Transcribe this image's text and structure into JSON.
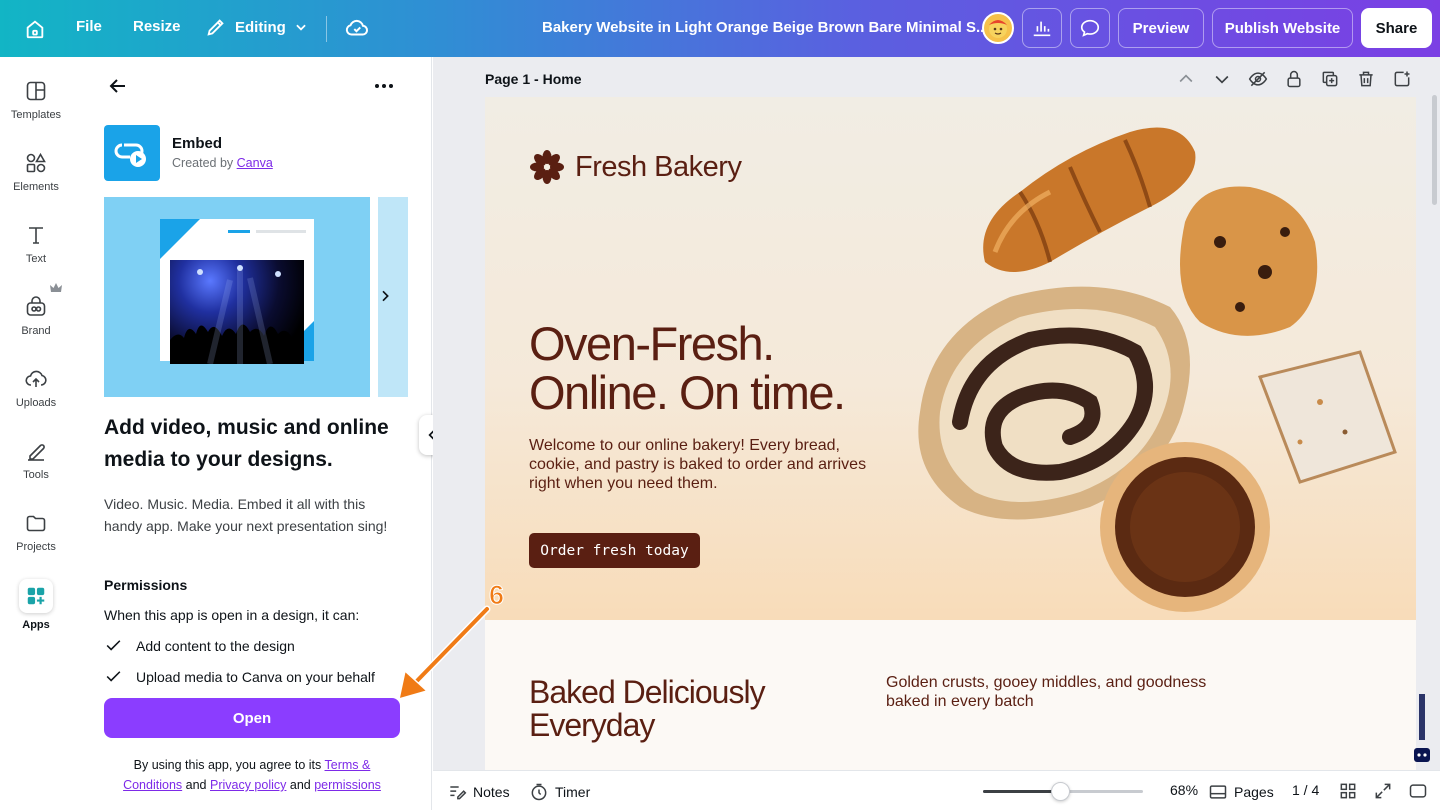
{
  "topbar": {
    "file": "File",
    "resize": "Resize",
    "editing": "Editing",
    "title": "Bakery Website in Light Orange Beige Brown Bare Minimal S...",
    "preview": "Preview",
    "publish": "Publish Website",
    "share": "Share"
  },
  "rail": {
    "items": [
      {
        "label": "Templates",
        "icon": "templates-icon"
      },
      {
        "label": "Elements",
        "icon": "elements-icon"
      },
      {
        "label": "Text",
        "icon": "text-icon"
      },
      {
        "label": "Brand",
        "icon": "brand-icon"
      },
      {
        "label": "Uploads",
        "icon": "uploads-icon"
      },
      {
        "label": "Tools",
        "icon": "tools-icon"
      },
      {
        "label": "Projects",
        "icon": "projects-icon"
      },
      {
        "label": "Apps",
        "icon": "apps-icon"
      }
    ]
  },
  "panel": {
    "app_name": "Embed",
    "created_by": "Created by",
    "creator": "Canva",
    "heading": "Add video, music and online media to your designs.",
    "description": "Video. Music. Media. Embed it all with this handy app. Make your next presentation sing!",
    "permissions_title": "Permissions",
    "permissions_intro": "When this app is open in a design, it can:",
    "permissions": [
      "Add content to the design",
      "Upload media to Canva on your behalf"
    ],
    "open_button": "Open",
    "legal": {
      "prefix": "By using this app, you agree to its",
      "terms": "Terms & Conditions",
      "and1": "and",
      "privacy": "Privacy policy",
      "and2": "and",
      "permissions": "permissions"
    }
  },
  "canvas": {
    "page_label": "Page 1 - Home",
    "design": {
      "logo": "Fresh Bakery",
      "hero_title_line1": "Oven-Fresh.",
      "hero_title_line2": "Online. On time.",
      "hero_text": "Welcome to our online bakery! Every bread, cookie, and pastry is baked to order and arrives right when you need them.",
      "hero_button": "Order fresh today",
      "section_title_line1": "Baked Deliciously",
      "section_title_line2": "Everyday",
      "section_text": "Golden crusts, gooey middles, and goodness baked in every batch"
    }
  },
  "bottombar": {
    "notes": "Notes",
    "timer": "Timer",
    "zoom": "68%",
    "zoom_fraction": 0.49,
    "pages": "Pages",
    "page_count": "1 / 4"
  },
  "annotation": {
    "step": "6",
    "color": "#f07b16"
  },
  "colors": {
    "brand_purple": "#8b3dff",
    "bakery_brown": "#5a1f12"
  }
}
